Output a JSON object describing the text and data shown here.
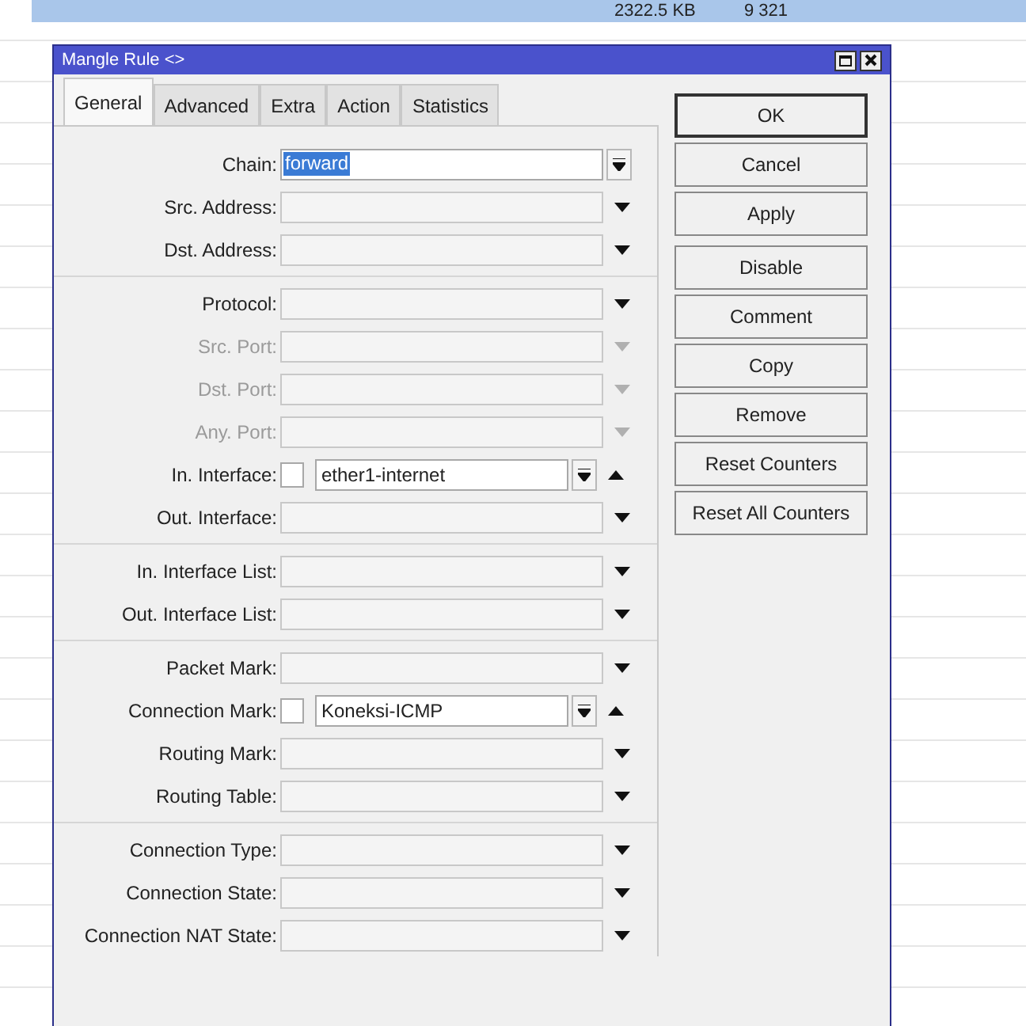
{
  "background_row": {
    "cells": [
      "2322.5 KB",
      "9 321"
    ]
  },
  "window": {
    "title": "Mangle Rule <>"
  },
  "tabs": [
    {
      "label": "General",
      "selected": true
    },
    {
      "label": "Advanced",
      "selected": false
    },
    {
      "label": "Extra",
      "selected": false
    },
    {
      "label": "Action",
      "selected": false
    },
    {
      "label": "Statistics",
      "selected": false
    }
  ],
  "groups": [
    [
      {
        "label": "Chain:",
        "kind": "chain",
        "disabled": false,
        "value": "forward",
        "selected": true
      },
      {
        "label": "Src. Address:",
        "kind": "dropdown",
        "disabled": false
      },
      {
        "label": "Dst. Address:",
        "kind": "dropdown",
        "disabled": false
      }
    ],
    [
      {
        "label": "Protocol:",
        "kind": "dropdown",
        "disabled": false
      },
      {
        "label": "Src. Port:",
        "kind": "dropdown",
        "disabled": true
      },
      {
        "label": "Dst. Port:",
        "kind": "dropdown",
        "disabled": true
      },
      {
        "label": "Any. Port:",
        "kind": "dropdown",
        "disabled": true
      },
      {
        "label": "In. Interface:",
        "kind": "negatable",
        "disabled": false,
        "checked": false,
        "value": "ether1-internet"
      },
      {
        "label": "Out. Interface:",
        "kind": "dropdown",
        "disabled": false
      }
    ],
    [
      {
        "label": "In. Interface List:",
        "kind": "dropdown",
        "disabled": false
      },
      {
        "label": "Out. Interface List:",
        "kind": "dropdown",
        "disabled": false
      }
    ],
    [
      {
        "label": "Packet Mark:",
        "kind": "dropdown",
        "disabled": false
      },
      {
        "label": "Connection Mark:",
        "kind": "negatable",
        "disabled": false,
        "checked": false,
        "value": "Koneksi-ICMP"
      },
      {
        "label": "Routing Mark:",
        "kind": "dropdown",
        "disabled": false
      },
      {
        "label": "Routing Table:",
        "kind": "dropdown",
        "disabled": false
      }
    ],
    [
      {
        "label": "Connection Type:",
        "kind": "dropdown",
        "disabled": false
      },
      {
        "label": "Connection State:",
        "kind": "dropdown",
        "disabled": false
      },
      {
        "label": "Connection NAT State:",
        "kind": "dropdown",
        "disabled": false
      }
    ]
  ],
  "button_groups": [
    [
      "OK",
      "Cancel",
      "Apply"
    ],
    [
      "Disable",
      "Comment",
      "Copy",
      "Remove",
      "Reset Counters",
      "Reset All Counters"
    ]
  ]
}
